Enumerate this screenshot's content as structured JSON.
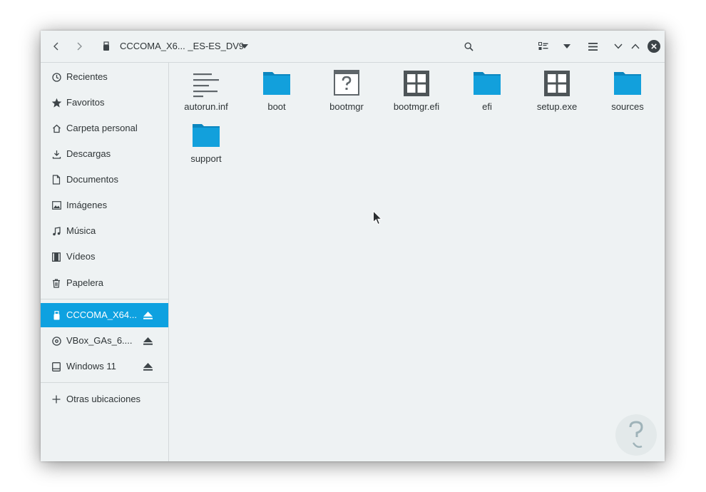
{
  "header": {
    "title": "CCCOMA_X6... _ES-ES_DV9",
    "back_icon": "chevron-left-icon",
    "forward_icon": "chevron-right-icon",
    "drive_icon": "usb-drive-icon",
    "dropdown_icon": "triangle-down-icon",
    "search_icon": "search-icon",
    "view_icon": "view-list-icon",
    "view_options_icon": "triangle-down-icon",
    "menu_icon": "hamburger-menu-icon",
    "minimize_icon": "chevron-down-icon",
    "maximize_icon": "chevron-up-icon",
    "close_icon": "close-icon"
  },
  "sidebar": {
    "places": [
      {
        "label": "Recientes",
        "icon": "clock-icon"
      },
      {
        "label": "Favoritos",
        "icon": "star-icon"
      },
      {
        "label": "Carpeta personal",
        "icon": "home-icon"
      },
      {
        "label": "Descargas",
        "icon": "download-icon"
      },
      {
        "label": "Documentos",
        "icon": "document-icon"
      },
      {
        "label": "Imágenes",
        "icon": "image-icon"
      },
      {
        "label": "Música",
        "icon": "music-icon"
      },
      {
        "label": "Vídeos",
        "icon": "film-icon"
      },
      {
        "label": "Papelera",
        "icon": "trash-icon"
      }
    ],
    "devices": [
      {
        "label": "CCCOMA_X64...",
        "icon": "usb-drive-icon",
        "active": true
      },
      {
        "label": "VBox_GAs_6....",
        "icon": "optical-disc-icon",
        "active": false
      },
      {
        "label": "Windows 11",
        "icon": "hard-drive-icon",
        "active": false
      }
    ],
    "other_locations": {
      "label": "Otras ubicaciones",
      "icon": "plus-icon"
    }
  },
  "files": [
    {
      "name": "autorun.inf",
      "type": "text",
      "icon": "text-file-icon"
    },
    {
      "name": "boot",
      "type": "folder",
      "icon": "folder-icon"
    },
    {
      "name": "bootmgr",
      "type": "unknown",
      "icon": "unknown-file-icon"
    },
    {
      "name": "bootmgr.efi",
      "type": "executable",
      "icon": "executable-icon"
    },
    {
      "name": "efi",
      "type": "folder",
      "icon": "folder-icon"
    },
    {
      "name": "setup.exe",
      "type": "executable",
      "icon": "executable-icon"
    },
    {
      "name": "sources",
      "type": "folder",
      "icon": "folder-icon"
    },
    {
      "name": "support",
      "type": "folder",
      "icon": "folder-icon"
    }
  ],
  "colors": {
    "accent": "#0ea1e0",
    "folder": "#12a0dc",
    "folder_tab": "#0b86bf",
    "window_bg": "#eef2f3"
  }
}
